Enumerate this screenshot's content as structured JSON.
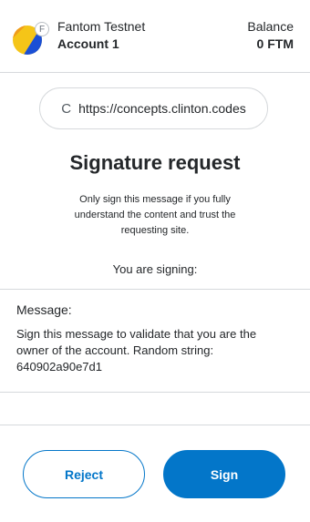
{
  "header": {
    "network_badge": "F",
    "network_name": "Fantom Testnet",
    "account_name": "Account 1",
    "balance_label": "Balance",
    "balance_value": "0 FTM"
  },
  "site": {
    "icon": "C",
    "url": "https://concepts.clinton.codes"
  },
  "title": "Signature request",
  "warning": "Only sign this message if you fully understand the content and trust the requesting site.",
  "signing_label": "You are signing:",
  "message": {
    "label": "Message:",
    "text": "Sign this message to validate that you are the owner of the account. Random string: 640902a90e7d1"
  },
  "buttons": {
    "reject": "Reject",
    "sign": "Sign"
  },
  "colors": {
    "accent": "#0376c9",
    "border": "#d6d9dc",
    "avatar_yellow": "#f5c518",
    "avatar_blue": "#1a4fd6"
  }
}
